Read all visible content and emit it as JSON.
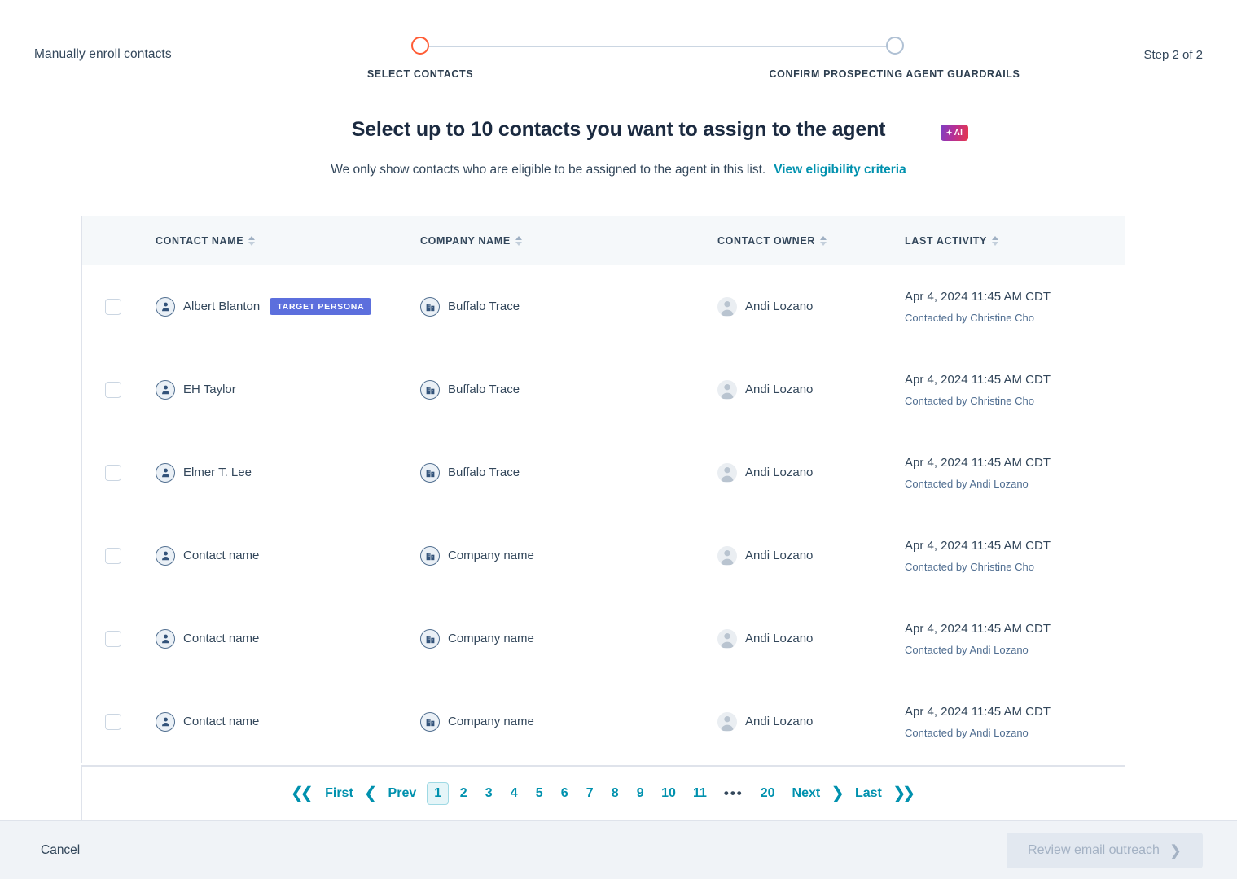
{
  "topbar": {
    "title": "Manually enroll contacts",
    "step_counter": "Step 2 of 2",
    "steps": [
      {
        "label": "SELECT CONTACTS",
        "state": "active"
      },
      {
        "label": "CONFIRM PROSPECTING AGENT GUARDRAILS",
        "state": "inactive"
      }
    ]
  },
  "heading": {
    "title": "Select up to 10 contacts you want to assign to the agent",
    "ai_badge": "AI",
    "ai_badge_spark": "✦",
    "subtitle": "We only show contacts who are eligible to be assigned to the agent in this list.",
    "eligibility_link": "View eligibility criteria"
  },
  "table": {
    "columns": [
      {
        "label": "CONTACT NAME"
      },
      {
        "label": "COMPANY NAME"
      },
      {
        "label": "CONTACT OWNER"
      },
      {
        "label": "LAST ACTIVITY"
      }
    ],
    "rows": [
      {
        "checked": false,
        "contact_name": "Albert Blanton",
        "badge": "TARGET PERSONA",
        "company_name": "Buffalo Trace",
        "contact_owner": "Andi Lozano",
        "last_activity_date": "Apr 4, 2024 11:45 AM CDT",
        "last_activity_by": "Contacted by Christine Cho"
      },
      {
        "checked": false,
        "contact_name": "EH Taylor",
        "badge": "",
        "company_name": "Buffalo Trace",
        "contact_owner": "Andi Lozano",
        "last_activity_date": "Apr 4, 2024 11:45 AM CDT",
        "last_activity_by": "Contacted by Christine Cho"
      },
      {
        "checked": false,
        "contact_name": "Elmer T. Lee",
        "badge": "",
        "company_name": "Buffalo Trace",
        "contact_owner": "Andi Lozano",
        "last_activity_date": "Apr 4, 2024 11:45 AM CDT",
        "last_activity_by": "Contacted by Andi Lozano"
      },
      {
        "checked": false,
        "contact_name": "Contact name",
        "badge": "",
        "company_name": "Company name",
        "contact_owner": "Andi Lozano",
        "last_activity_date": "Apr 4, 2024 11:45 AM CDT",
        "last_activity_by": "Contacted by Christine Cho"
      },
      {
        "checked": false,
        "contact_name": "Contact name",
        "badge": "",
        "company_name": "Company name",
        "contact_owner": "Andi Lozano",
        "last_activity_date": "Apr 4, 2024 11:45 AM CDT",
        "last_activity_by": "Contacted by Andi Lozano"
      },
      {
        "checked": false,
        "contact_name": "Contact name",
        "badge": "",
        "company_name": "Company name",
        "contact_owner": "Andi Lozano",
        "last_activity_date": "Apr 4, 2024 11:45 AM CDT",
        "last_activity_by": "Contacted by Andi Lozano"
      }
    ]
  },
  "pagination": {
    "first": "First",
    "prev": "Prev",
    "next": "Next",
    "last": "Last",
    "ellipsis": "•••",
    "current_page": "1",
    "pages": [
      "1",
      "2",
      "3",
      "4",
      "5",
      "6",
      "7",
      "8",
      "9",
      "10",
      "11"
    ],
    "last_page": "20"
  },
  "footer": {
    "cancel": "Cancel",
    "primary": "Review email outreach",
    "primary_arrow": "❯",
    "primary_disabled": true
  },
  "colors": {
    "accent_orange": "#ff5c35",
    "link_teal": "#0091ae",
    "badge_indigo": "#5c6fdd",
    "text_dark": "#33475b",
    "header_bg": "#f5f8fa",
    "footer_bg": "#f0f3f7"
  }
}
